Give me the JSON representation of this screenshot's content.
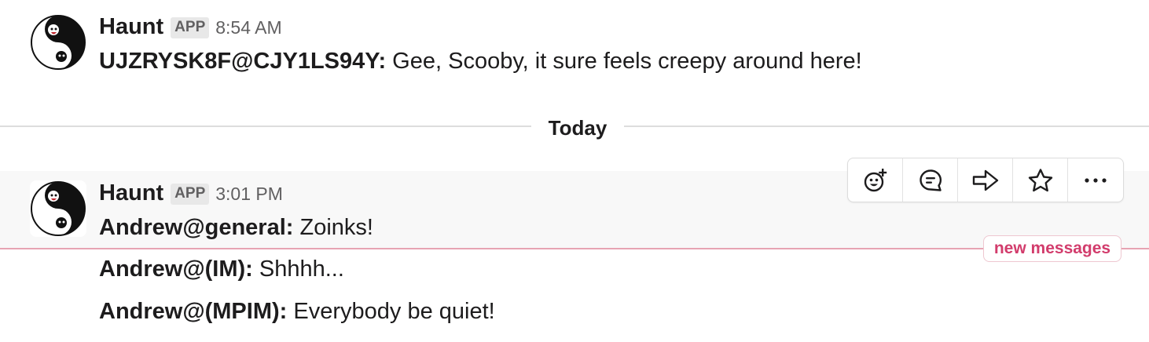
{
  "messages": [
    {
      "sender": "Haunt",
      "badge": "APP",
      "time": "8:54 AM",
      "lines": [
        {
          "author": "UJZRYSK8F@CJY1LS94Y:",
          "text": " Gee, Scooby, it sure feels creepy around here!"
        }
      ]
    },
    {
      "sender": "Haunt",
      "badge": "APP",
      "time": "3:01 PM",
      "lines": [
        {
          "author": "Andrew@general:",
          "text": " Zoinks!"
        },
        {
          "author": "Andrew@(IM):",
          "text": " Shhhh..."
        },
        {
          "author": "Andrew@(MPIM):",
          "text": " Everybody be quiet!"
        }
      ]
    }
  ],
  "day_divider": "Today",
  "new_messages_label": "new messages",
  "actions": [
    {
      "icon": "add-reaction-icon"
    },
    {
      "icon": "reply-thread-icon"
    },
    {
      "icon": "share-message-icon"
    },
    {
      "icon": "star-icon"
    },
    {
      "icon": "more-actions-icon"
    }
  ],
  "colors": {
    "text": "#1d1c1d",
    "muted": "#616061",
    "new_messages": "#d23c6c",
    "divider": "#dddddd"
  }
}
